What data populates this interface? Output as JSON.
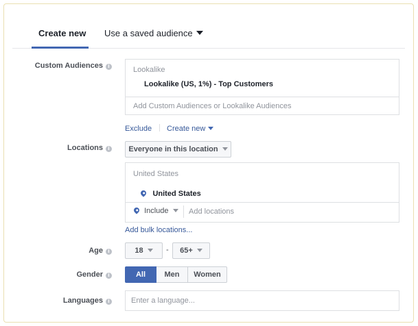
{
  "tabs": {
    "create_new": "Create new",
    "saved_audience": "Use a saved audience"
  },
  "custom_audiences": {
    "label": "Custom Audiences",
    "group_heading": "Lookalike",
    "selected_item": "Lookalike (US, 1%) - Top Customers",
    "placeholder": "Add Custom Audiences or Lookalike Audiences",
    "exclude_link": "Exclude",
    "create_new_link": "Create new"
  },
  "locations": {
    "label": "Locations",
    "scope_dropdown": "Everyone in this location",
    "group_heading": "United States",
    "selected_item": "United States",
    "include_dropdown": "Include",
    "placeholder": "Add locations",
    "bulk_link": "Add bulk locations..."
  },
  "age": {
    "label": "Age",
    "min": "18",
    "separator": "-",
    "max": "65+"
  },
  "gender": {
    "label": "Gender",
    "options": [
      "All",
      "Men",
      "Women"
    ],
    "selected": "All"
  },
  "languages": {
    "label": "Languages",
    "placeholder": "Enter a language..."
  },
  "colors": {
    "accent": "#4267b2",
    "link": "#365899",
    "frame_border": "#eadfb0"
  },
  "icons": [
    "info-icon",
    "location-pin-icon",
    "caret-down-icon"
  ]
}
